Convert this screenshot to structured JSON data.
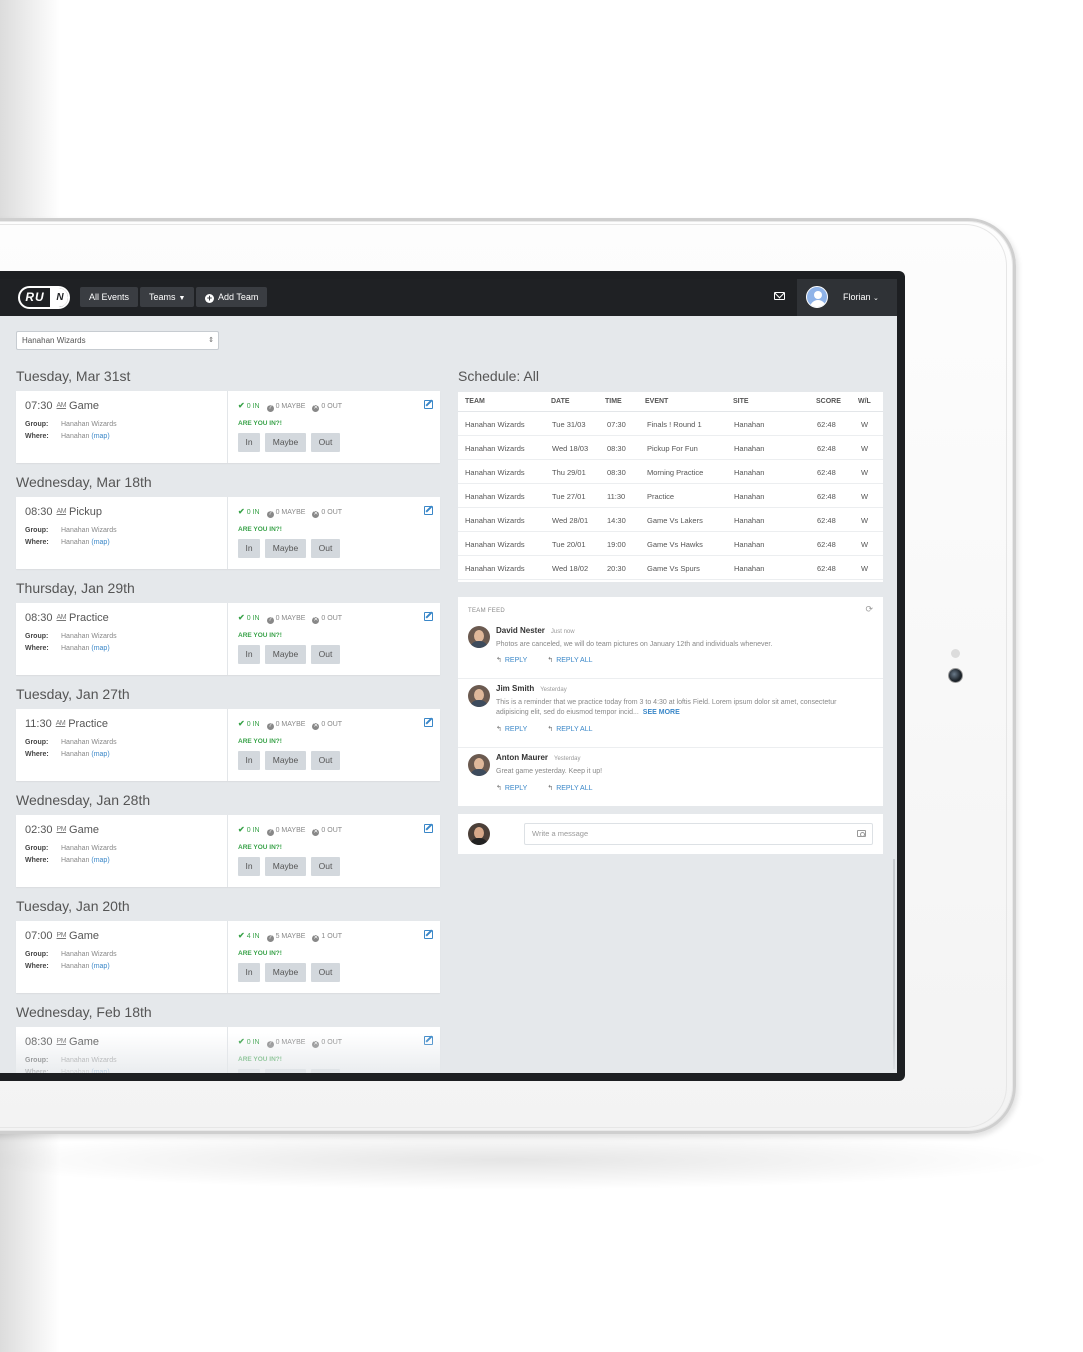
{
  "nav": {
    "logo_left": "RU",
    "logo_right": "N",
    "all_events": "All Events",
    "teams": "Teams",
    "add_team": "Add Team",
    "user_name": "Florian"
  },
  "team_select": {
    "value": "Hanahan Wizards"
  },
  "labels": {
    "group": "Group:",
    "where": "Where:",
    "map": "(map)",
    "are_you_in": "ARE YOU IN?!",
    "in_btn": "In",
    "maybe_btn": "Maybe",
    "out_btn": "Out",
    "in_suffix": "IN",
    "maybe_suffix": "MAYBE",
    "out_suffix": "OUT"
  },
  "events": [
    {
      "day": "Tuesday, Mar 31st",
      "time": "07:30",
      "ampm": "AM",
      "type": "Game",
      "group": "Hanahan Wizards",
      "where": "Hanahan",
      "in": "0",
      "maybe": "0",
      "out": "0"
    },
    {
      "day": "Wednesday, Mar 18th",
      "time": "08:30",
      "ampm": "AM",
      "type": "Pickup",
      "group": "Hanahan Wizards",
      "where": "Hanahan",
      "in": "0",
      "maybe": "0",
      "out": "0"
    },
    {
      "day": "Thursday, Jan 29th",
      "time": "08:30",
      "ampm": "AM",
      "type": "Practice",
      "group": "Hanahan Wizards",
      "where": "Hanahan",
      "in": "0",
      "maybe": "0",
      "out": "0"
    },
    {
      "day": "Tuesday, Jan 27th",
      "time": "11:30",
      "ampm": "AM",
      "type": "Practice",
      "group": "Hanahan Wizards",
      "where": "Hanahan",
      "in": "0",
      "maybe": "0",
      "out": "0"
    },
    {
      "day": "Wednesday, Jan 28th",
      "time": "02:30",
      "ampm": "PM",
      "type": "Game",
      "group": "Hanahan Wizards",
      "where": "Hanahan",
      "in": "0",
      "maybe": "0",
      "out": "0"
    },
    {
      "day": "Tuesday, Jan 20th",
      "time": "07:00",
      "ampm": "PM",
      "type": "Game",
      "group": "Hanahan Wizards",
      "where": "Hanahan",
      "in": "4",
      "maybe": "5",
      "out": "1"
    },
    {
      "day": "Wednesday, Feb 18th",
      "time": "08:30",
      "ampm": "PM",
      "type": "Game",
      "group": "Hanahan Wizards",
      "where": "Hanahan",
      "in": "0",
      "maybe": "0",
      "out": "0"
    }
  ],
  "schedule": {
    "title": "Schedule: All",
    "headers": [
      "TEAM",
      "DATE",
      "TIME",
      "EVENT",
      "SITE",
      "SCORE",
      "W/L"
    ],
    "rows": [
      [
        "Hanahan Wizards",
        "Tue 31/03",
        "07:30",
        "Finals ! Round 1",
        "Hanahan",
        "62:48",
        "W"
      ],
      [
        "Hanahan Wizards",
        "Wed 18/03",
        "08:30",
        "Pickup For Fun",
        "Hanahan",
        "62:48",
        "W"
      ],
      [
        "Hanahan Wizards",
        "Thu 29/01",
        "08:30",
        "Morning Practice",
        "Hanahan",
        "62:48",
        "W"
      ],
      [
        "Hanahan Wizards",
        "Tue 27/01",
        "11:30",
        "Practice",
        "Hanahan",
        "62:48",
        "W"
      ],
      [
        "Hanahan Wizards",
        "Wed 28/01",
        "14:30",
        "Game Vs Lakers",
        "Hanahan",
        "62:48",
        "W"
      ],
      [
        "Hanahan Wizards",
        "Tue 20/01",
        "19:00",
        "Game Vs Hawks",
        "Hanahan",
        "62:48",
        "W"
      ],
      [
        "Hanahan Wizards",
        "Wed 18/02",
        "20:30",
        "Game Vs Spurs",
        "Hanahan",
        "62:48",
        "W"
      ]
    ]
  },
  "feed": {
    "title": "TEAM FEED",
    "reply": "REPLY",
    "reply_all": "REPLY ALL",
    "see_more": "SEE MORE",
    "posts": [
      {
        "name": "David Nester",
        "when": "Just now",
        "text": "Photos are canceled, we will do team pictures on January 12th and individuals whenever."
      },
      {
        "name": "Jim Smith",
        "when": "Yesterday",
        "text": "This is a reminder that we practice today from 3 to 4:30 at loftis Field. Lorem ipsum dolor sit amet, consectetur adipisicing elit, sed do eiusmod tempor incid..."
      },
      {
        "name": "Anton Maurer",
        "when": "Yesterday",
        "text": "Great game yesterday. Keep it up!"
      }
    ],
    "composer_placeholder": "Write a message"
  },
  "icons": {
    "mail": "mail-icon",
    "edit": "edit-icon",
    "refresh": "refresh-icon",
    "camera": "camera-icon",
    "reply": "reply-icon",
    "reply_all": "reply-all-icon"
  },
  "colors": {
    "navbar": "#1f2124",
    "accent_green": "#3aa34a",
    "link_blue": "#3a87c8",
    "screen_bg": "#e5e8eb"
  }
}
